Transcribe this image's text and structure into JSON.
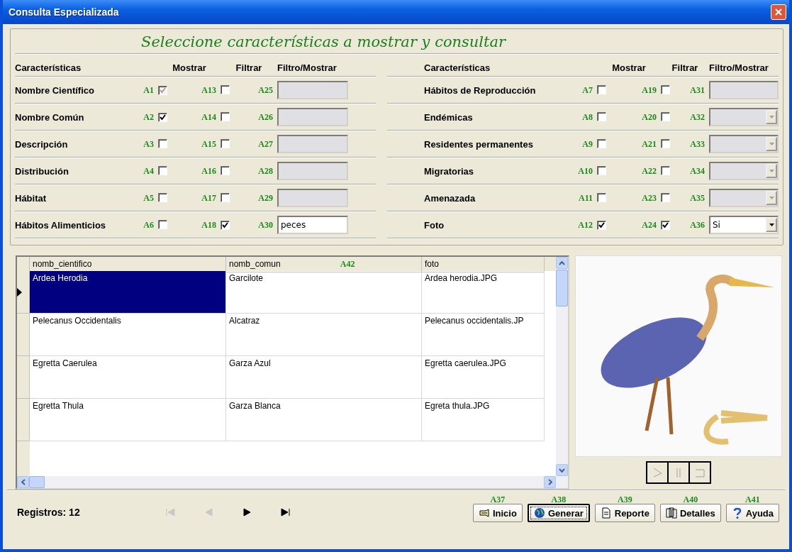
{
  "window": {
    "title": "Consulta Especializada"
  },
  "panel_title": "Seleccione características a mostrar y consultar",
  "headers_left": [
    "Características",
    "Mostrar",
    "Filtrar",
    "Filtro/Mostrar"
  ],
  "headers_right": [
    "Características",
    "Mostrar",
    "Filtrar",
    "Filtro/Mostrar"
  ],
  "rows_left": [
    {
      "name": "Nombre Científico",
      "show_tag": "A1",
      "show_checked": true,
      "show_disabled": true,
      "filter_tag": "A13",
      "filter_checked": false,
      "field_tag": "A25",
      "kind": "text",
      "field_enabled": false
    },
    {
      "name": "Nombre Común",
      "show_tag": "A2",
      "show_checked": true,
      "show_disabled": false,
      "filter_tag": "A14",
      "filter_checked": false,
      "field_tag": "A26",
      "kind": "text",
      "field_enabled": false
    },
    {
      "name": "Descripción",
      "show_tag": "A3",
      "show_checked": false,
      "show_disabled": false,
      "filter_tag": "A15",
      "filter_checked": false,
      "field_tag": "A27",
      "kind": "text",
      "field_enabled": false
    },
    {
      "name": "Distribución",
      "show_tag": "A4",
      "show_checked": false,
      "show_disabled": false,
      "filter_tag": "A16",
      "filter_checked": false,
      "field_tag": "A28",
      "kind": "text",
      "field_enabled": false
    },
    {
      "name": "Hábitat",
      "show_tag": "A5",
      "show_checked": false,
      "show_disabled": false,
      "filter_tag": "A17",
      "filter_checked": false,
      "field_tag": "A29",
      "kind": "text",
      "field_enabled": false
    },
    {
      "name": "Hábitos Alimenticios",
      "show_tag": "A6",
      "show_checked": false,
      "show_disabled": false,
      "filter_tag": "A18",
      "filter_checked": true,
      "field_tag": "A30",
      "kind": "text",
      "field_enabled": true,
      "value": "peces"
    }
  ],
  "rows_right": [
    {
      "name": "Hábitos de Reproducción",
      "show_tag": "A7",
      "show_checked": false,
      "show_disabled": false,
      "filter_tag": "A19",
      "filter_checked": false,
      "field_tag": "A31",
      "kind": "text",
      "field_enabled": false
    },
    {
      "name": "Endémicas",
      "show_tag": "A8",
      "show_checked": false,
      "show_disabled": false,
      "filter_tag": "A20",
      "filter_checked": false,
      "field_tag": "A32",
      "kind": "combo",
      "field_enabled": false
    },
    {
      "name": "Residentes permanentes",
      "show_tag": "A9",
      "show_checked": false,
      "show_disabled": false,
      "filter_tag": "A21",
      "filter_checked": false,
      "field_tag": "A33",
      "kind": "combo",
      "field_enabled": false
    },
    {
      "name": "Migratorias",
      "show_tag": "A10",
      "show_checked": false,
      "show_disabled": false,
      "filter_tag": "A22",
      "filter_checked": false,
      "field_tag": "A34",
      "kind": "combo",
      "field_enabled": false
    },
    {
      "name": "Amenazada",
      "show_tag": "A11",
      "show_checked": false,
      "show_disabled": false,
      "filter_tag": "A23",
      "filter_checked": false,
      "field_tag": "A35",
      "kind": "combo",
      "field_enabled": false
    },
    {
      "name": "Foto",
      "show_tag": "A12",
      "show_checked": true,
      "show_disabled": false,
      "filter_tag": "A24",
      "filter_checked": true,
      "field_tag": "A36",
      "kind": "combo",
      "field_enabled": true,
      "value": "Si"
    }
  ],
  "grid": {
    "columns": [
      "nomb_cientifico",
      "nomb_comun",
      "foto"
    ],
    "column_tag": "A42",
    "rows": [
      {
        "cells": [
          "Ardea Herodia",
          "Garcilote",
          "Ardea herodia.JPG"
        ],
        "selected": true
      },
      {
        "cells": [
          "Pelecanus Occidentalis",
          "Alcatraz",
          "Pelecanus occidentalis.JP"
        ],
        "selected": false
      },
      {
        "cells": [
          "Egretta Caerulea",
          "Garza Azul",
          "Egretta caerulea.JPG"
        ],
        "selected": false
      },
      {
        "cells": [
          "Egretta Thula",
          "Garza Blanca",
          "Egreta thula.JPG"
        ],
        "selected": false
      }
    ]
  },
  "media_controls": [
    {
      "kind": "play",
      "disabled": true
    },
    {
      "kind": "pause",
      "disabled": true
    },
    {
      "kind": "stop",
      "disabled": true
    }
  ],
  "footer": {
    "records": "Registros: 12",
    "nav": [
      {
        "kind": "first",
        "disabled": true
      },
      {
        "kind": "prev",
        "disabled": true
      },
      {
        "kind": "next",
        "disabled": false
      },
      {
        "kind": "last",
        "disabled": false
      }
    ],
    "buttons": [
      {
        "tag": "A37",
        "label": "Inicio",
        "focused": false
      },
      {
        "tag": "A38",
        "label": "Generar",
        "focused": true
      },
      {
        "tag": "A39",
        "label": "Reporte",
        "focused": false
      },
      {
        "tag": "A40",
        "label": "Detalles",
        "focused": false
      },
      {
        "tag": "A41",
        "label": "Ayuda",
        "focused": false
      }
    ]
  }
}
